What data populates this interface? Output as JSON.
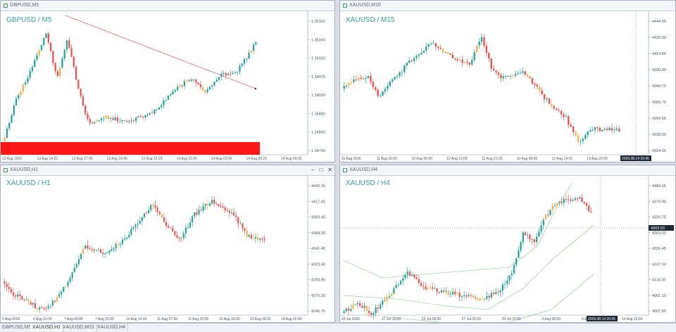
{
  "windows": [
    {
      "id": "w1",
      "title": "GBPUSD,M5",
      "label": "GBPUSD / M5",
      "buttons": [],
      "y_ticks": [
        "1.35110",
        "1.35065",
        "1.35020",
        "1.34975",
        "1.34930",
        "1.34885",
        "1.34840",
        "1.34795"
      ],
      "x_ticks": [
        "13 Aug 2026",
        "13 Aug 14:25",
        "13 Aug 17:05",
        "13 Aug 19:45",
        "13 Aug 22:25",
        "14 Aug 01:05",
        "14 Aug 03:45",
        "14 Aug 06:25",
        "14 Aug 09:05"
      ]
    },
    {
      "id": "w2",
      "title": "XAUUSD,M15",
      "label": "XAUUSD / M15",
      "buttons": [],
      "y_ticks": [
        "4444.95",
        "4429.90",
        "4414.85",
        "4399.80",
        "4384.75",
        "4369.70",
        "4354.65",
        "4339.60",
        "4324.55"
      ],
      "x_ticks": [
        "11 Aug 2026",
        "11 Aug 20:00",
        "12 Aug 05:00",
        "12 Aug 13:00",
        "12 Aug 21:00",
        "13 Aug 06:00",
        "13 Aug 14:00",
        "13 Aug 22:00",
        "14 Aug 07:00"
      ],
      "time_badge": "2026.08.14 20:45"
    },
    {
      "id": "w3",
      "title": "XAUUSD,H1",
      "label": "XAUUSD / H1",
      "buttons": [
        "–",
        "□",
        "✕"
      ],
      "y_ticks": [
        "4442.15",
        "4417.80",
        "4393.45",
        "4368.90",
        "4341.45",
        "4319.40",
        "4294.85",
        "4270.30",
        "4245.75"
      ],
      "x_ticks": [
        "6 Aug 2026",
        "6 Aug 12:00",
        "7 Aug 06:00",
        "7 Aug 21:00",
        "10 Aug 14:00",
        "11 Aug 07:00",
        "11 Aug 23:00",
        "12 Aug 16:00",
        "13 Aug 09:00",
        "14 Aug 02:00"
      ]
    },
    {
      "id": "w4",
      "title": "XAUUSD,H4",
      "label": "XAUUSD / H4",
      "buttons": [],
      "y_ticks": [
        "4483.05",
        "4379.90",
        "4326.75",
        "4303.03",
        "4231.45",
        "4167.30",
        "4118.30",
        "4061.10",
        "4007.85"
      ],
      "x_ticks": [
        "15 Jul 2026",
        "17 Jul 16:00",
        "22 Jul 08:00",
        "27 Jul 00:00",
        "29 Jul 16:00",
        "3 Aug 08:00",
        "6 Aug 00:00",
        "10 Aug 16:00"
      ],
      "price_badge": "4303.03",
      "time_badge": "2026.08.14 20:45"
    }
  ],
  "taskbar": {
    "tabs": [
      "GBPUSD,M5",
      "XAUUSD,H1",
      "XAUUSD,M15",
      "XAUUSD,H4"
    ],
    "active": 1
  },
  "colors": {
    "up": "#26a69a",
    "down": "#ef5350",
    "neutral": "#f0b54a",
    "trendline": "#e06d6d",
    "red_zone": "#ff1616",
    "bands": "#4caf50"
  }
}
